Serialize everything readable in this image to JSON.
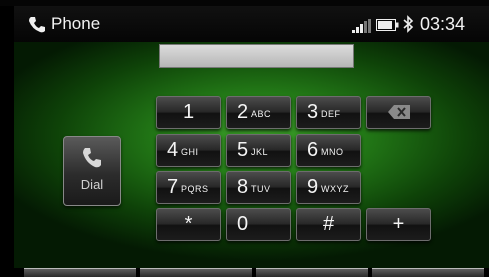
{
  "status_bar": {
    "title": "Phone",
    "time": "03:34",
    "icons": [
      "phone-icon",
      "signal-icon",
      "battery-icon",
      "bluetooth-icon"
    ]
  },
  "number_field": {
    "value": ""
  },
  "dial_button": {
    "label": "Dial",
    "icon": "handset-icon"
  },
  "keypad": [
    {
      "digit": "1",
      "letters": ""
    },
    {
      "digit": "2",
      "letters": "ABC"
    },
    {
      "digit": "3",
      "letters": "DEF"
    },
    {
      "digit": "4",
      "letters": "GHI"
    },
    {
      "digit": "5",
      "letters": "JKL"
    },
    {
      "digit": "6",
      "letters": "MNO"
    },
    {
      "digit": "7",
      "letters": "PQRS"
    },
    {
      "digit": "8",
      "letters": "TUV"
    },
    {
      "digit": "9",
      "letters": "WXYZ"
    },
    {
      "digit": "*",
      "letters": ""
    },
    {
      "digit": "0",
      "letters": ""
    },
    {
      "digit": "#",
      "letters": ""
    },
    {
      "digit": "+",
      "letters": ""
    }
  ],
  "backspace": {
    "icon": "backspace-icon"
  },
  "colors": {
    "background": "#000000",
    "panel_green": "#2e8f20",
    "key_face": "#262626",
    "text": "#f2f2f2"
  }
}
